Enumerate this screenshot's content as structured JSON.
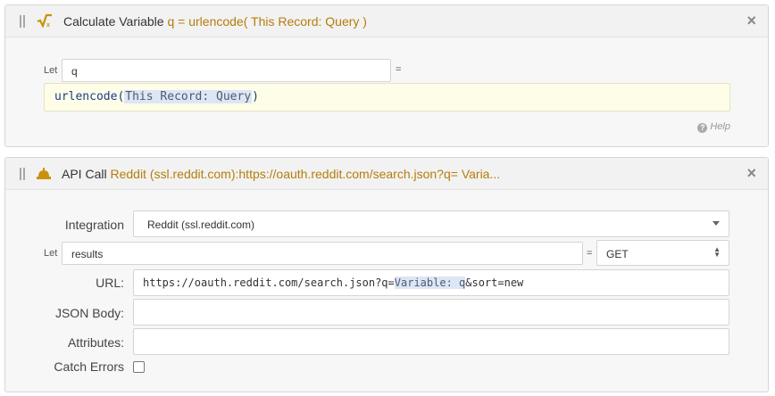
{
  "calc_panel": {
    "title_prefix": "Calculate Variable",
    "title_detail": "q = urlencode( This Record: Query )",
    "icon": "square-root-icon",
    "close": "×",
    "let_label": "Let",
    "variable_name": "q",
    "equals": "=",
    "formula": {
      "function": "urlencode",
      "open": "(",
      "token": "This Record: Query",
      "close": ")"
    },
    "help_label": "Help",
    "help_icon": "?"
  },
  "api_panel": {
    "title_prefix": "API Call",
    "title_detail": "Reddit (ssl.reddit.com):https://oauth.reddit.com/search.json?q= Varia...",
    "icon": "bell-icon",
    "close": "×",
    "integration_label": "Integration",
    "integration_value": "Reddit (ssl.reddit.com)",
    "let_label": "Let",
    "result_variable": "results",
    "equals": "=",
    "method": "GET",
    "url_label": "URL:",
    "url": {
      "before": "https://oauth.reddit.com/search.json?q=",
      "token": "Variable: q",
      "after": "&sort=new"
    },
    "json_body_label": "JSON Body:",
    "json_body_value": "",
    "attributes_label": "Attributes:",
    "attributes_value": "",
    "catch_errors_label": "Catch Errors",
    "catch_errors_checked": false
  },
  "colors": {
    "accent_text": "#b57d0a",
    "formula_bg": "#fefde8",
    "token_bg": "#dde6f3"
  }
}
